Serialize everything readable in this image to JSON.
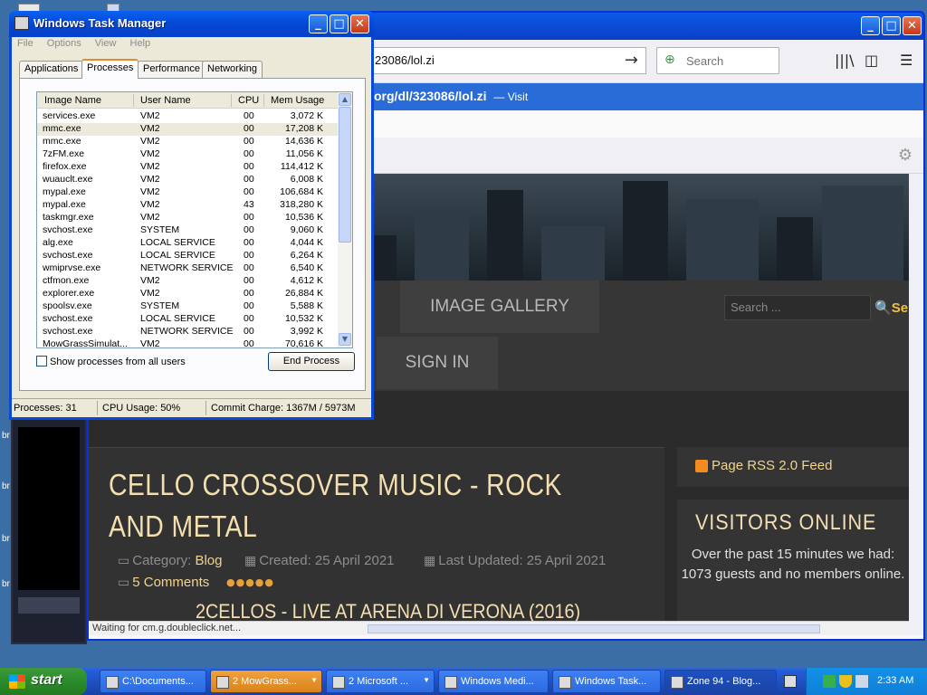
{
  "browser": {
    "url_fragment": "23086/lol.zi",
    "search_placeholder": "Search",
    "suggestion_url": "org/dl/323086/lol.zi",
    "suggestion_action": "— Visit",
    "status_text": "Waiting for cm.g.doubleclick.net...",
    "page": {
      "menu": [
        "IMAGE GALLERY",
        "SIGN IN"
      ],
      "site_search_placeholder": "Search ...",
      "site_search_button": "Se",
      "article_title": "CELLO CROSSOVER MUSIC - ROCK AND METAL",
      "category_label": "Category:",
      "category_value": "Blog",
      "created": "Created: 25 April 2021",
      "updated": "Last Updated: 25 April 2021",
      "comments": "5 Comments",
      "subtitle": "2CELLOS - LIVE AT ARENA DI VERONA (2016)",
      "rss": "Page RSS 2.0 Feed",
      "visitors_title": "VISITORS ONLINE",
      "visitors_text": "Over the past 15 minutes we had: 1073 guests and no members online."
    }
  },
  "taskmgr": {
    "title": "Windows Task Manager",
    "menu": [
      "File",
      "Options",
      "View",
      "Help"
    ],
    "tabs": [
      "Applications",
      "Processes",
      "Performance",
      "Networking"
    ],
    "active_tab": "Processes",
    "columns": [
      "Image Name",
      "User Name",
      "CPU",
      "Mem Usage"
    ],
    "processes": [
      {
        "name": "services.exe",
        "user": "VM2",
        "cpu": "00",
        "mem": "3,072 K"
      },
      {
        "name": "mmc.exe",
        "user": "VM2",
        "cpu": "00",
        "mem": "17,208 K"
      },
      {
        "name": "mmc.exe",
        "user": "VM2",
        "cpu": "00",
        "mem": "14,636 K"
      },
      {
        "name": "7zFM.exe",
        "user": "VM2",
        "cpu": "00",
        "mem": "11,056 K"
      },
      {
        "name": "firefox.exe",
        "user": "VM2",
        "cpu": "00",
        "mem": "114,412 K"
      },
      {
        "name": "wuauclt.exe",
        "user": "VM2",
        "cpu": "00",
        "mem": "6,008 K"
      },
      {
        "name": "mypal.exe",
        "user": "VM2",
        "cpu": "00",
        "mem": "106,684 K"
      },
      {
        "name": "mypal.exe",
        "user": "VM2",
        "cpu": "43",
        "mem": "318,280 K"
      },
      {
        "name": "taskmgr.exe",
        "user": "VM2",
        "cpu": "00",
        "mem": "10,536 K"
      },
      {
        "name": "svchost.exe",
        "user": "SYSTEM",
        "cpu": "00",
        "mem": "9,060 K"
      },
      {
        "name": "alg.exe",
        "user": "LOCAL SERVICE",
        "cpu": "00",
        "mem": "4,044 K"
      },
      {
        "name": "svchost.exe",
        "user": "LOCAL SERVICE",
        "cpu": "00",
        "mem": "6,264 K"
      },
      {
        "name": "wmiprvse.exe",
        "user": "NETWORK SERVICE",
        "cpu": "00",
        "mem": "6,540 K"
      },
      {
        "name": "ctfmon.exe",
        "user": "VM2",
        "cpu": "00",
        "mem": "4,612 K"
      },
      {
        "name": "explorer.exe",
        "user": "VM2",
        "cpu": "00",
        "mem": "26,884 K"
      },
      {
        "name": "spoolsv.exe",
        "user": "SYSTEM",
        "cpu": "00",
        "mem": "5,588 K"
      },
      {
        "name": "svchost.exe",
        "user": "LOCAL SERVICE",
        "cpu": "00",
        "mem": "10,532 K"
      },
      {
        "name": "svchost.exe",
        "user": "NETWORK SERVICE",
        "cpu": "00",
        "mem": "3,992 K"
      },
      {
        "name": "MowGrassSimulat...",
        "user": "VM2",
        "cpu": "00",
        "mem": "70,616 K"
      }
    ],
    "selected_row": 1,
    "show_all_label": "Show processes from all users",
    "end_process_label": "End Process",
    "status": {
      "processes": "Processes: 31",
      "cpu": "CPU Usage: 50%",
      "commit": "Commit Charge: 1367M / 5973M"
    }
  },
  "taskbar": {
    "start_label": "start",
    "buttons": [
      {
        "label": "C:\\Documents...",
        "style": "normal"
      },
      {
        "label": "2 MowGrass...",
        "style": "orange"
      },
      {
        "label": "2 Microsoft ...",
        "style": "normal"
      },
      {
        "label": "Windows Medi...",
        "style": "normal"
      },
      {
        "label": "Windows Task...",
        "style": "normal"
      },
      {
        "label": "Zone 94 - Blog...",
        "style": "active"
      }
    ],
    "clock": "2:33 AM"
  }
}
